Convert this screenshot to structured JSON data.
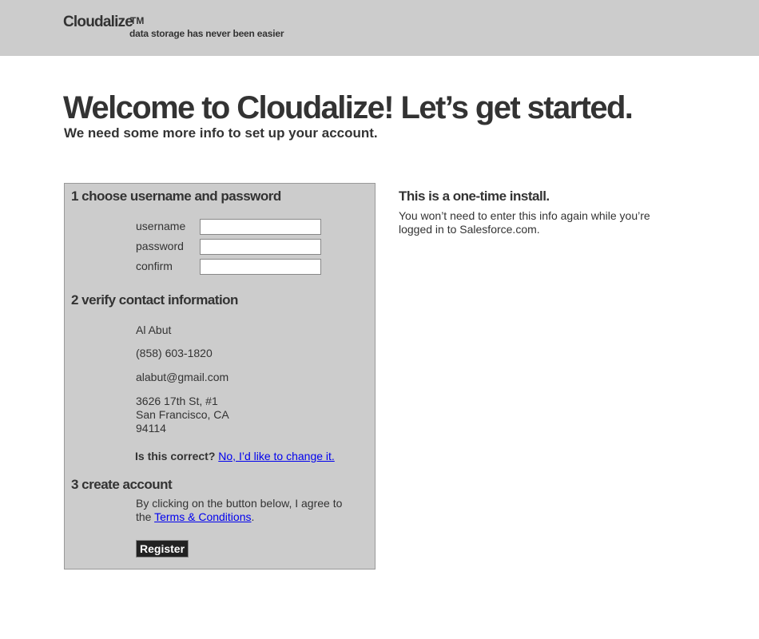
{
  "header": {
    "brand": "Cloudalize",
    "trademark": "TM",
    "tagline": "data storage has never been easier"
  },
  "intro": {
    "title": "Welcome to Cloudalize! Let’s get started.",
    "subtitle": "We need some more info to set up your account."
  },
  "form": {
    "step1": {
      "heading": "1 choose username and password",
      "fields": [
        {
          "label": "username",
          "value": "",
          "placeholder": ""
        },
        {
          "label": "password",
          "value": "",
          "placeholder": ""
        },
        {
          "label": "confirm",
          "value": "",
          "placeholder": ""
        }
      ]
    },
    "step2": {
      "heading": "2 verify contact information",
      "name": "Al Abut",
      "phone": "(858) 603-1820",
      "email": "alabut@gmail.com",
      "address_line1": "3626 17th St, #1",
      "address_line2": "San Francisco, CA",
      "address_line3": "94114",
      "confirm_question": "Is this correct?",
      "change_link": "No, I’d like to change it."
    },
    "step3": {
      "heading": "3 create account",
      "agree_text_before": "By clicking on the button below, I agree to the ",
      "terms_link": "Terms & Conditions",
      "agree_text_after": ".",
      "register_label": "Register"
    }
  },
  "sidebar": {
    "heading": "This is a one-time install.",
    "text": "You won’t need to enter this info again while you’re logged in to Salesforce.com."
  }
}
